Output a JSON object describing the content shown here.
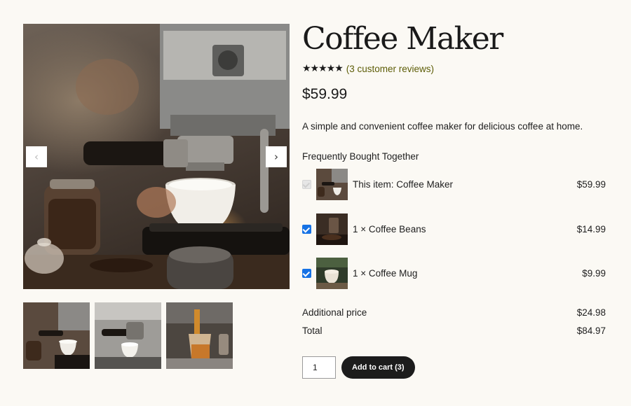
{
  "product": {
    "title": "Coffee Maker",
    "rating_stars": "★★★★★",
    "rating_value": 5,
    "reviews_link": "(3 customer reviews)",
    "price": "$59.99",
    "description": "A simple and convenient coffee maker for delicious coffee at home."
  },
  "gallery": {
    "prev_arrow": "‹",
    "next_arrow": "›"
  },
  "bundle": {
    "heading": "Frequently Bought Together",
    "items": [
      {
        "name": "This item: Coffee Maker",
        "price": "$59.99",
        "checked": true,
        "disabled": true
      },
      {
        "name": "1 × Coffee Beans",
        "price": "$14.99",
        "checked": true,
        "disabled": false
      },
      {
        "name": "1 × Coffee Mug",
        "price": "$9.99",
        "checked": true,
        "disabled": false
      }
    ],
    "additional_label": "Additional price",
    "additional_value": "$24.98",
    "total_label": "Total",
    "total_value": "$84.97"
  },
  "cart": {
    "quantity": "1",
    "add_label": "Add to cart (3)"
  },
  "colors": {
    "background": "#fbf9f4",
    "button": "#1c1c1c",
    "checkbox": "#1672e5",
    "link": "#5d5d07"
  }
}
